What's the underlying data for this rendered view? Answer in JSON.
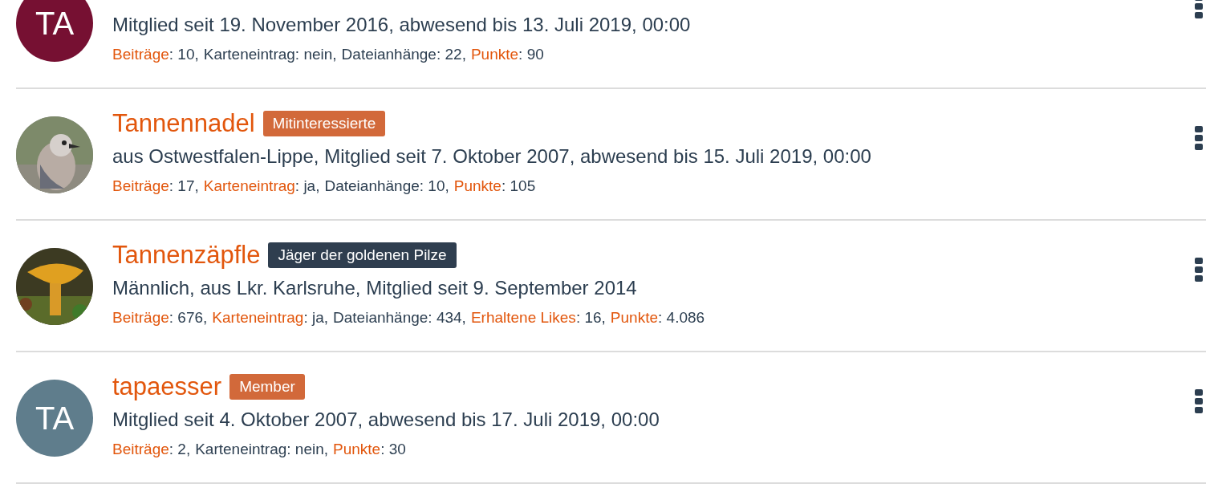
{
  "members": [
    {
      "avatar": {
        "kind": "initials",
        "text": "TA",
        "color": "#761032"
      },
      "details": "Mitglied seit 19. November 2016, abwesend bis 13. Juli 2019, 00:00",
      "stats": [
        {
          "label": "Beiträge",
          "value": ": 10,",
          "highlighted": true
        },
        {
          "label": "Karteneintrag",
          "value": ": nein,",
          "highlighted": false
        },
        {
          "label": "Dateianhänge",
          "value": ": 22,",
          "highlighted": false
        },
        {
          "label": "Punkte",
          "value": ": 90",
          "highlighted": true
        }
      ]
    },
    {
      "name": "Tannennadel",
      "badge": {
        "text": "Mitinteressierte",
        "color": "#d2693a"
      },
      "avatar": {
        "kind": "picture"
      },
      "details": "aus Ostwestfalen-Lippe, Mitglied seit 7. Oktober 2007, abwesend bis 15. Juli 2019, 00:00",
      "stats": [
        {
          "label": "Beiträge",
          "value": ": 17,",
          "highlighted": true
        },
        {
          "label": "Karteneintrag",
          "value": ": ja,",
          "highlighted": true
        },
        {
          "label": "Dateianhänge",
          "value": ": 10,",
          "highlighted": false
        },
        {
          "label": "Punkte",
          "value": ": 105",
          "highlighted": true
        }
      ]
    },
    {
      "name": "Tannenzäpfle",
      "badge": {
        "text": "Jäger der goldenen Pilze",
        "color": "#2f3e4f"
      },
      "avatar": {
        "kind": "picture"
      },
      "details": "Männlich, aus Lkr. Karlsruhe, Mitglied seit 9. September 2014",
      "stats": [
        {
          "label": "Beiträge",
          "value": ": 676,",
          "highlighted": true
        },
        {
          "label": "Karteneintrag",
          "value": ": ja,",
          "highlighted": true
        },
        {
          "label": "Dateianhänge",
          "value": ": 434,",
          "highlighted": false
        },
        {
          "label": "Erhaltene Likes",
          "value": ": 16,",
          "highlighted": true
        },
        {
          "label": "Punkte",
          "value": ": 4.086",
          "highlighted": true
        }
      ]
    },
    {
      "name": "tapaesser",
      "badge": {
        "text": "Member",
        "color": "#d2693a"
      },
      "avatar": {
        "kind": "initials",
        "text": "TA",
        "color": "#5f7d8c"
      },
      "details": "Mitglied seit 4. Oktober 2007, abwesend bis 17. Juli 2019, 00:00",
      "stats": [
        {
          "label": "Beiträge",
          "value": ": 2,",
          "highlighted": true
        },
        {
          "label": "Karteneintrag",
          "value": ": nein,",
          "highlighted": false
        },
        {
          "label": "Punkte",
          "value": ": 30",
          "highlighted": true
        }
      ]
    }
  ]
}
